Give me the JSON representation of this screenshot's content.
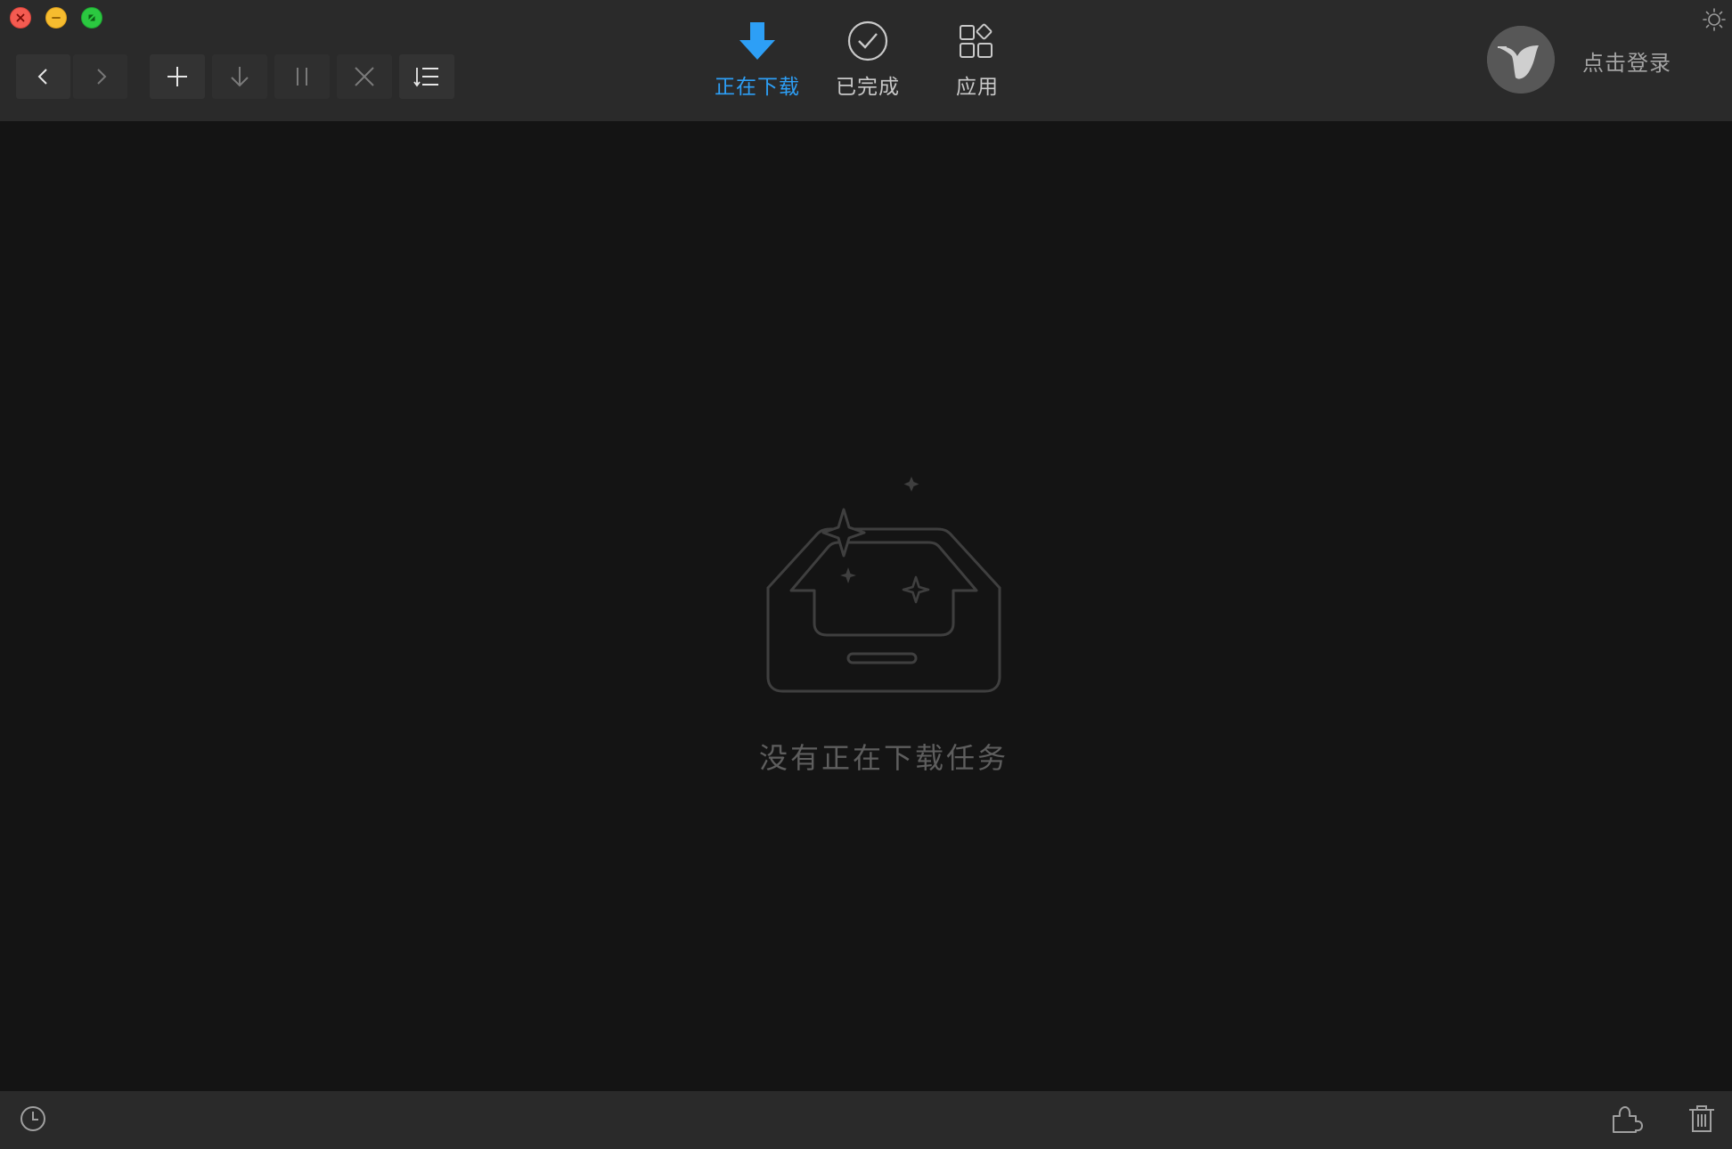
{
  "window": {
    "controls": {
      "close": "close-icon",
      "minimize": "minimize-icon",
      "maximize": "fullscreen-icon"
    }
  },
  "toolbar": {
    "buttons": [
      {
        "name": "back-button",
        "icon": "chevron-left-icon",
        "enabled": true
      },
      {
        "name": "forward-button",
        "icon": "chevron-right-icon",
        "enabled": false
      },
      {
        "name": "new-task-button",
        "icon": "plus-icon",
        "enabled": true
      },
      {
        "name": "start-download-button",
        "icon": "arrow-down-icon",
        "enabled": false
      },
      {
        "name": "pause-button",
        "icon": "pause-icon",
        "enabled": false
      },
      {
        "name": "delete-task-button",
        "icon": "x-icon",
        "enabled": false
      },
      {
        "name": "sort-button",
        "icon": "sort-list-icon",
        "enabled": true
      }
    ]
  },
  "tabs": [
    {
      "label": "正在下载",
      "icon": "download-arrow-icon",
      "active": true
    },
    {
      "label": "已完成",
      "icon": "check-circle-icon",
      "active": false
    },
    {
      "label": "应用",
      "icon": "apps-grid-icon",
      "active": false
    }
  ],
  "user": {
    "login_label": "点击登录",
    "avatar_icon": "bird-avatar-icon"
  },
  "theme_toggle_icon": "sun-icon",
  "empty_state": {
    "message": "没有正在下载任务",
    "illustration": "empty-inbox-icon"
  },
  "footer": {
    "left_icon": "clock-icon",
    "right_icons": [
      "plugin-puzzle-icon",
      "trash-icon"
    ]
  },
  "colors": {
    "accent": "#2d9ff6",
    "header_bg": "#2a2a2a",
    "content_bg": "#141414"
  }
}
